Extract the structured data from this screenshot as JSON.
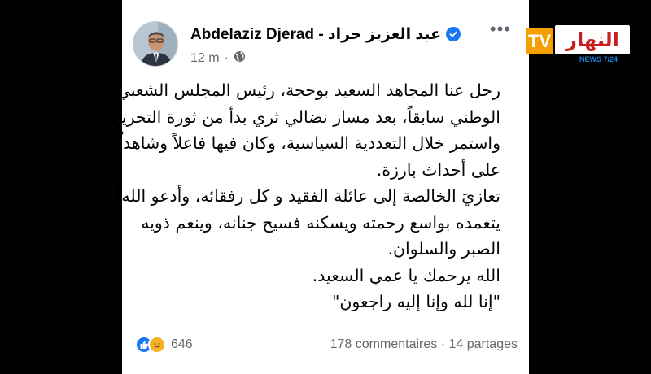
{
  "post": {
    "author": "Abdelaziz Djerad - عبد العزيز جراد",
    "timestamp": "12 m",
    "separator": "·",
    "audience_icon": "globe-icon",
    "more_label": "•••",
    "lines": [
      "رحل عنا المجاهد السعيد بوحجة، رئيس المجلس الشعبي",
      "الوطني سابقاً، بعد مسار نضالي ثري بدأ من ثورة التحرير،",
      "واستمر خلال التعددية السياسية، وكان فيها فاعلاً وشاهداً",
      "على أحداث بارزة.",
      "تعازيَ الخالصة إلى عائلة الفقيد و كل رفقائه، وأدعو الله أن",
      "يتغمده بواسع رحمته ويسكنه فسيح جنانه، وينعم ذويه",
      "الصبر والسلوان.",
      "الله يرحمك يا عمي السعيد.",
      "\"إنا لله وإنا إليه راجعون\""
    ],
    "reactions": {
      "count": "646",
      "icons": [
        "like-icon",
        "sad-icon"
      ]
    },
    "comments": "178 commentaires",
    "shares": "14 partages",
    "stats_separator": "·"
  },
  "channel_logo": {
    "tv": "TV",
    "brand": "النهار",
    "news": "NEWS 7/24",
    "colors": {
      "tv": "#f5a000",
      "brand": "#c81e1e",
      "news": "#1c7ad1"
    }
  },
  "colors": {
    "verified": "#1877f2",
    "like": "#1877f2",
    "sad": "#f7b125"
  }
}
